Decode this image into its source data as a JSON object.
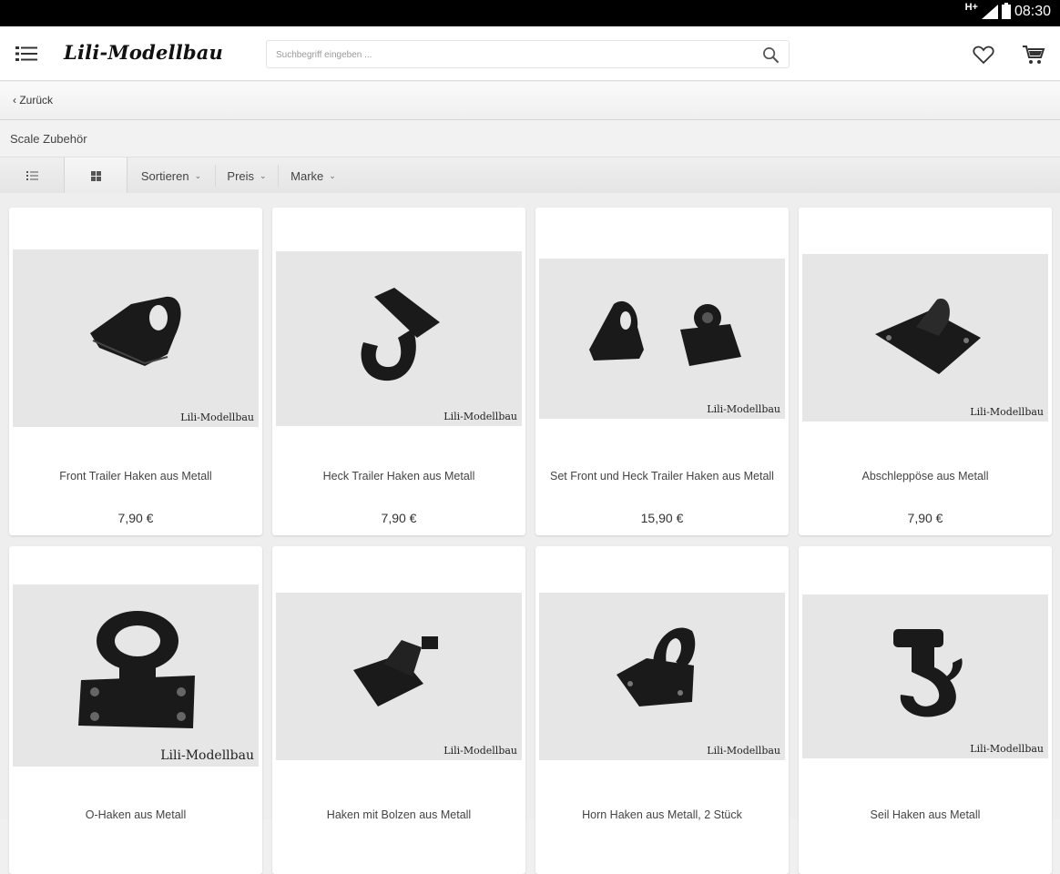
{
  "status": {
    "network": "H+",
    "time": "08:30"
  },
  "header": {
    "logo": "Lili-Modellbau",
    "search_placeholder": "Suchbegriff eingeben ..."
  },
  "back_label": "Zurück",
  "category": {
    "title": "Scale Zubehör",
    "sort_label": "Sortieren",
    "price_label": "Preis",
    "brand_label": "Marke"
  },
  "products": [
    {
      "title": "Front Trailer Haken aus Metall",
      "price": "7,90 €",
      "watermark": "Lili-Modellbau"
    },
    {
      "title": "Heck Trailer Haken aus Metall",
      "price": "7,90 €",
      "watermark": "Lili-Modellbau"
    },
    {
      "title": "Set Front und Heck Trailer Haken aus Metall",
      "price": "15,90 €",
      "watermark": "Lili-Modellbau"
    },
    {
      "title": "Abschleppöse aus Metall",
      "price": "7,90 €",
      "watermark": "Lili-Modellbau"
    },
    {
      "title": "O-Haken aus Metall",
      "watermark": "Lili-Modellbau"
    },
    {
      "title": "Haken mit Bolzen aus Metall",
      "watermark": "Lili-Modellbau"
    },
    {
      "title": "Horn Haken aus Metall, 2 Stück",
      "watermark": "Lili-Modellbau"
    },
    {
      "title": "Seil Haken aus Metall",
      "watermark": "Lili-Modellbau"
    }
  ]
}
